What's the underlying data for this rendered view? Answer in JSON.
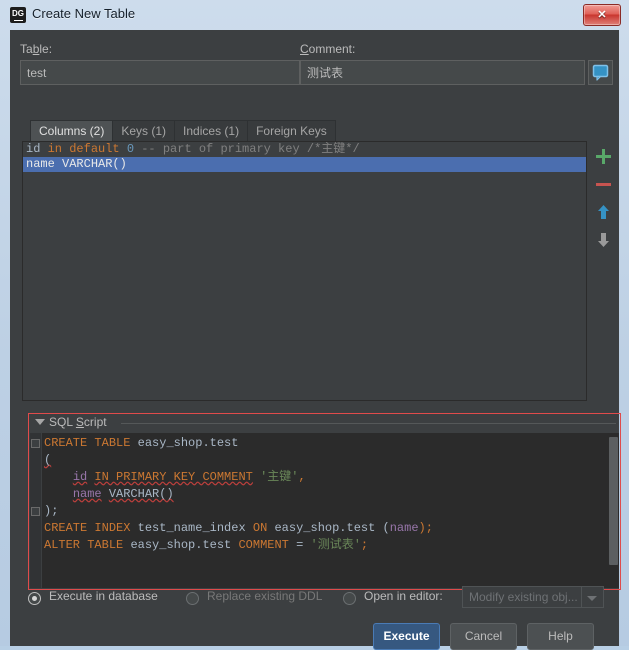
{
  "window": {
    "title": "Create New Table",
    "app_icon": "datagrip-icon",
    "close_label": "✕"
  },
  "form": {
    "table_label_pre": "Ta",
    "table_label_mnemonic": "b",
    "table_label_post": "le:",
    "table_label": "Table:",
    "table_value": "test",
    "comment_label_mnemonic": "C",
    "comment_label_post": "omment:",
    "comment_label": "Comment:",
    "comment_value": "测试表",
    "comment_icon": "comment-bubble-icon"
  },
  "tabs": [
    {
      "label": "Columns (2)",
      "active": true
    },
    {
      "label": "Keys (1)",
      "active": false
    },
    {
      "label": "Indices (1)",
      "active": false
    },
    {
      "label": "Foreign Keys",
      "active": false
    }
  ],
  "columns_list": {
    "rows": [
      {
        "selected": false,
        "name": "id",
        "keyword": "in default",
        "number": "0",
        "comment": "-- part of primary key /*主键*/"
      },
      {
        "selected": true,
        "name": "name",
        "type": "VARCHAR()"
      }
    ]
  },
  "list_toolbar": [
    {
      "name": "add-icon",
      "glyph": "+",
      "color": "#59a869"
    },
    {
      "name": "remove-icon",
      "glyph": "−",
      "color": "#c75450"
    },
    {
      "name": "move-up-icon",
      "glyph": "↑",
      "color": "#3592c4"
    },
    {
      "name": "move-down-icon",
      "glyph": "↓",
      "color": "#9a9a9a"
    }
  ],
  "sql_section": {
    "header_pre": "SQL ",
    "header_mnemonic": "S",
    "header_post": "cript",
    "header_label": "SQL Script",
    "collapse_icon": "chevron-down-icon",
    "border_color": "#e04b4b",
    "lines": [
      "CREATE TABLE easy_shop.test",
      "(",
      "    id IN PRIMARY KEY COMMENT '主键',",
      "    name VARCHAR()",
      ");",
      "CREATE INDEX test_name_index ON easy_shop.test (name);",
      "ALTER TABLE easy_shop.test COMMENT = '测试表';"
    ],
    "l1_kw1": "CREATE",
    "l1_kw2": "TABLE",
    "l1_obj": "easy_shop.test",
    "l2_paren": "(",
    "l3_col": "id",
    "l3_kw": "IN PRIMARY KEY COMMENT",
    "l3_str": "'主键'",
    "l3_comma": ",",
    "l4_col": "name",
    "l4_type": "VARCHAR()",
    "l5_close": ");",
    "l6_kw1": "CREATE",
    "l6_kw2": "INDEX",
    "l6_idx": "test_name_index",
    "l6_kw3": "ON",
    "l6_obj": "easy_shop.test",
    "l6_open": "(",
    "l6_col": "name",
    "l6_end": ");",
    "l7_kw1": "ALTER",
    "l7_kw2": "TABLE",
    "l7_obj": "easy_shop.test",
    "l7_kw3": "COMMENT",
    "l7_eq": "=",
    "l7_str": "'测试表'",
    "l7_end": ";"
  },
  "options": {
    "execute_in_database": "Execute in database",
    "replace_existing_ddl": "Replace existing DDL",
    "open_in_editor": "Open in editor:",
    "selected": "execute_in_database",
    "combo_value": "Modify existing obj...",
    "combo_enabled": false
  },
  "buttons": {
    "execute": "Execute",
    "cancel": "Cancel",
    "help": "Help"
  }
}
